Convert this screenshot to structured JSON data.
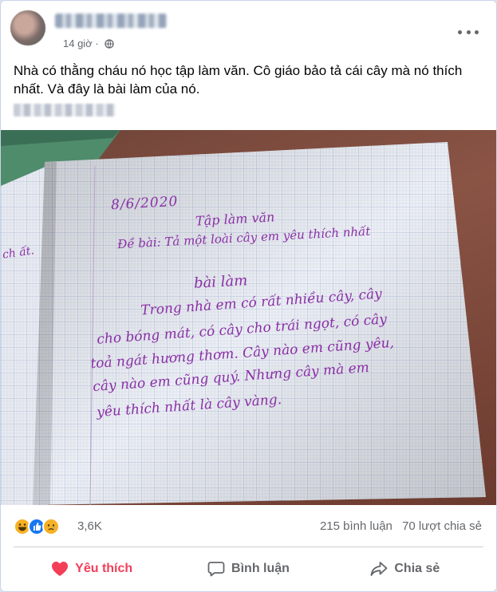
{
  "post": {
    "time": "14 giờ",
    "text": "Nhà có thằng cháu nó học tập làm văn. Cô giáo bảo tả cái cây mà nó thích nhất. Và đây là bài làm của nó."
  },
  "photo": {
    "date": "8/6/2020",
    "title": "Tập làm văn",
    "prompt": "Đề bài: Tả một loài cây em yêu thích nhất",
    "heading": "bài làm",
    "lines": [
      "Trong nhà em có rất nhiều cây, cây",
      "cho bóng mát, có cây cho trái ngọt, có cây",
      "toả ngát hương thơm. Cây nào em cũng yêu,",
      "cây nào em cũng quý. Nhưng cây mà em",
      "yêu thích nhất là cây vàng."
    ],
    "margin_fragment": "ch ất.",
    "ink_color": "#8a2fa6"
  },
  "stats": {
    "reaction_count": "3,6K",
    "comments": "215 bình luận",
    "shares": "70 lượt chia sẻ",
    "reaction_icons": [
      "haha-icon",
      "like-icon",
      "sad-icon"
    ]
  },
  "actions": {
    "like": "Yêu thích",
    "comment": "Bình luận",
    "share": "Chia sẻ"
  },
  "colors": {
    "like_active": "#f33e58",
    "secondary_text": "#65676b"
  }
}
